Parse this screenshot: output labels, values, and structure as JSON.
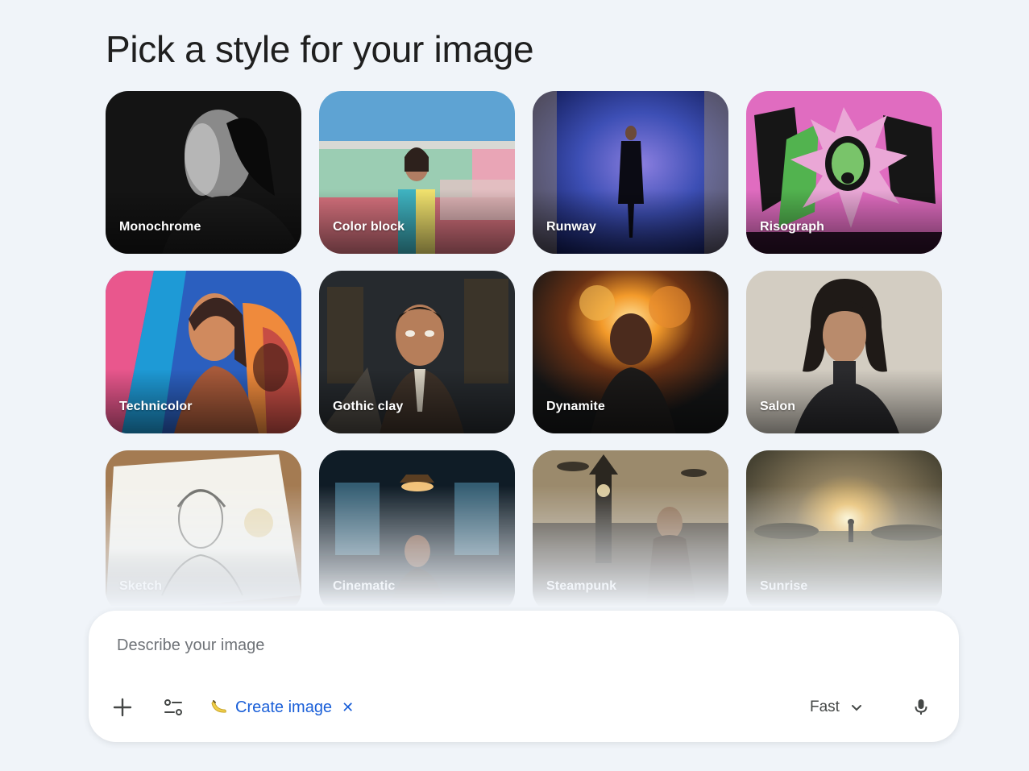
{
  "page": {
    "title": "Pick a style for your image"
  },
  "styles": [
    {
      "label": "Monochrome"
    },
    {
      "label": "Color block"
    },
    {
      "label": "Runway"
    },
    {
      "label": "Risograph"
    },
    {
      "label": "Technicolor"
    },
    {
      "label": "Gothic clay"
    },
    {
      "label": "Dynamite"
    },
    {
      "label": "Salon"
    },
    {
      "label": "Sketch"
    },
    {
      "label": "Cinematic"
    },
    {
      "label": "Steampunk"
    },
    {
      "label": "Sunrise"
    }
  ],
  "composer": {
    "placeholder": "Describe your image",
    "chip_label": "Create image",
    "chip_icon": "banana-icon",
    "model_label": "Fast",
    "icons": [
      "plus-icon",
      "tune-icon",
      "close-icon",
      "chevron-down-icon",
      "mic-icon"
    ],
    "accent_color": "#1a5fd8"
  }
}
